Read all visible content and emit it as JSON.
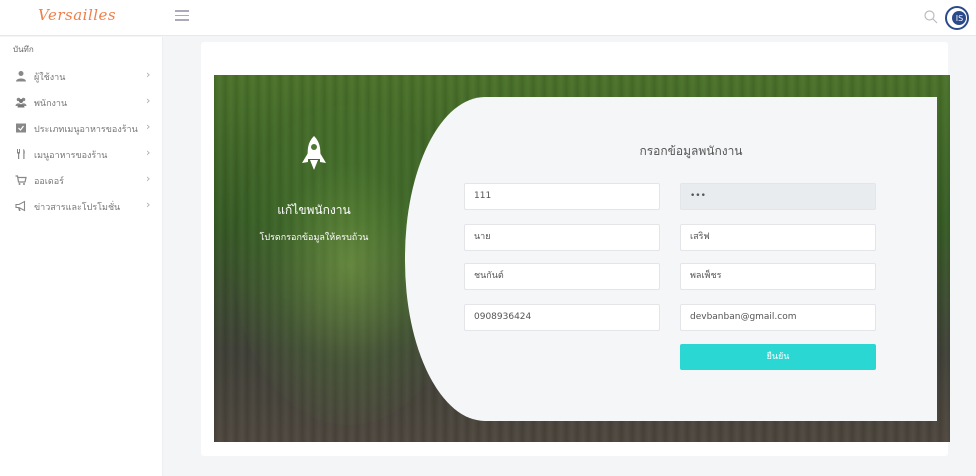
{
  "app": {
    "brand": "Versailles"
  },
  "colors": {
    "accent": "#2ad7d3",
    "brand": "#ef7f4a"
  },
  "sidebar": {
    "header": "บันทึก",
    "items": [
      {
        "label": "ผู้ใช้งาน",
        "icon": "user-icon"
      },
      {
        "label": "พนักงาน",
        "icon": "users-icon"
      },
      {
        "label": "ประเภทเมนูอาหารของร้าน",
        "icon": "category-icon"
      },
      {
        "label": "เมนูอาหารของร้าน",
        "icon": "utensils-icon"
      },
      {
        "label": "ออเดอร์",
        "icon": "cart-icon"
      },
      {
        "label": "ข่าวสารและโปรโมชั่น",
        "icon": "megaphone-icon"
      }
    ]
  },
  "hero": {
    "icon": "rocket-icon",
    "title": "แก้ไขพนักงาน",
    "subtitle": "โปรดกรอกข้อมูลให้ครบถ้วน"
  },
  "form": {
    "title": "กรอกข้อมูลพนักงาน",
    "fields": {
      "username": "111",
      "password": "•••",
      "prefix": "นาย",
      "nickname": "เสริฟ",
      "firstname": "ชนกันต์",
      "lastname": "พลเพ็ชร",
      "phone": "0908936424",
      "email": "devbanban@gmail.com"
    },
    "submit_label": "ยืนยัน"
  }
}
